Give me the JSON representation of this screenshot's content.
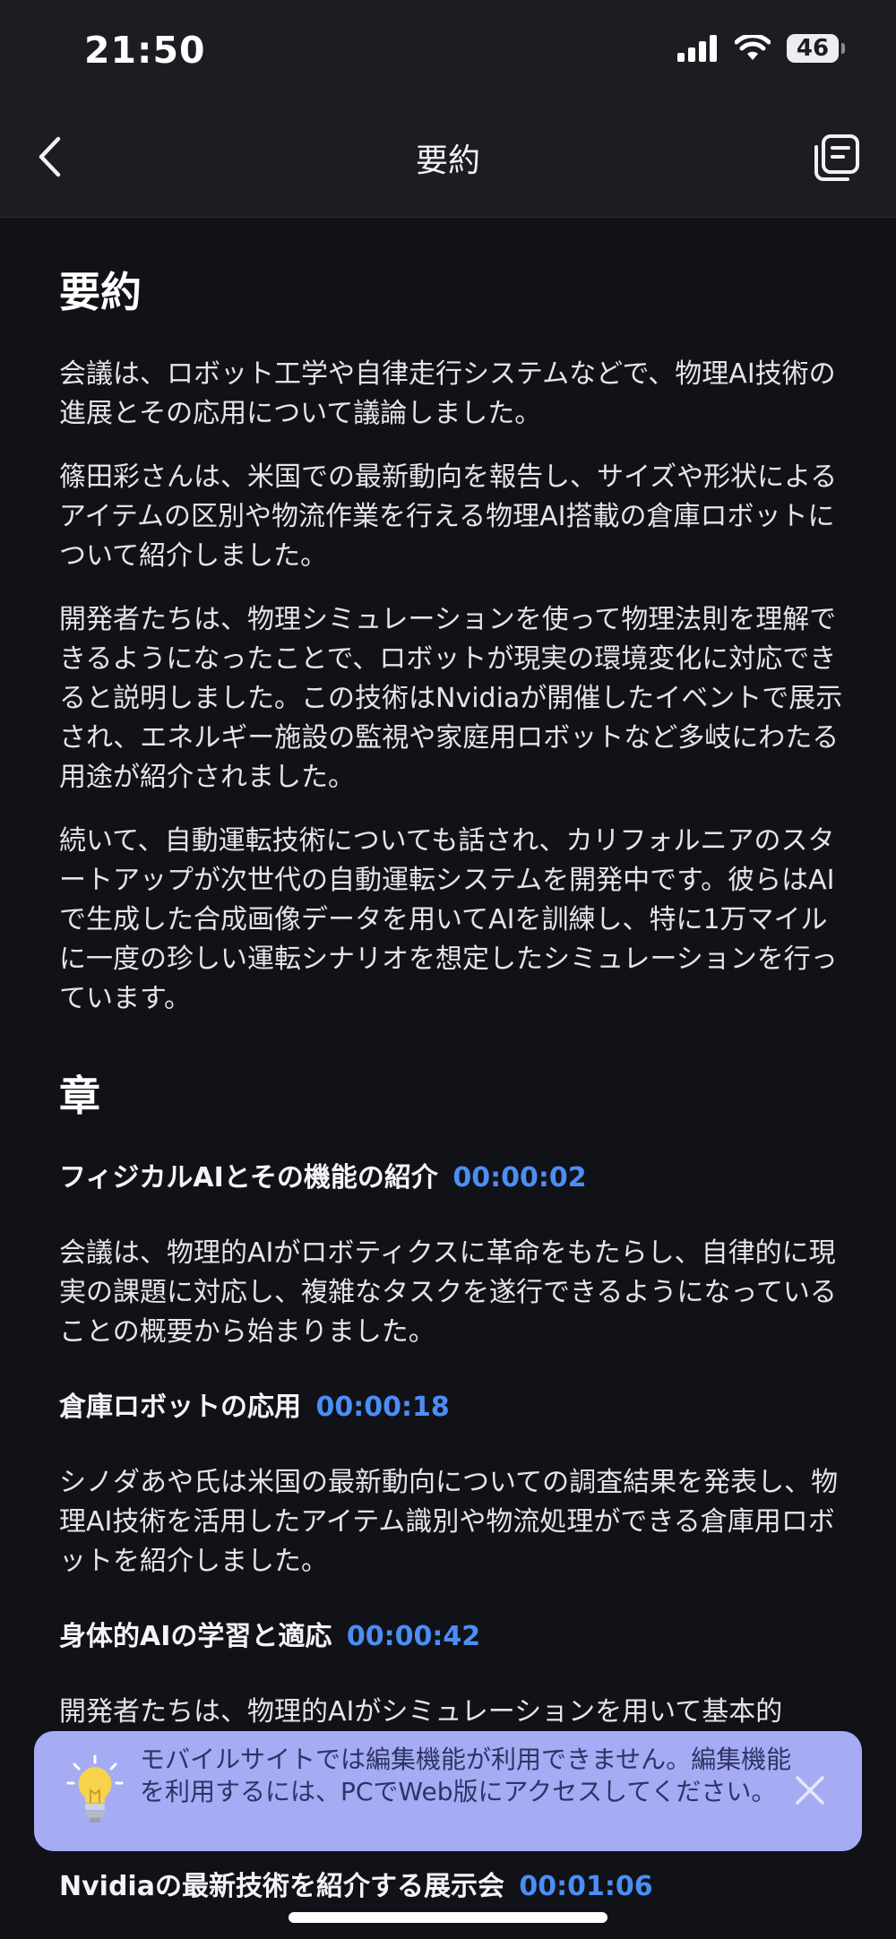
{
  "status": {
    "time": "21:50",
    "battery": "46",
    "icons": [
      "signal-icon",
      "wifi-icon",
      "battery-icon"
    ]
  },
  "nav": {
    "title": "要約",
    "back_icon": "chevron-left-icon",
    "action_icon": "transcript-icon"
  },
  "summary": {
    "heading": "要約",
    "paragraphs": [
      "会議は、ロボット工学や自律走行システムなどで、物理AI技術の進展とその応用について議論しました。",
      "篠田彩さんは、米国での最新動向を報告し、サイズや形状によるアイテムの区別や物流作業を行える物理AI搭載の倉庫ロボットについて紹介しました。",
      "開発者たちは、物理シミュレーションを使って物理法則を理解できるようになったことで、ロボットが現実の環境変化に対応できると説明しました。この技術はNvidiaが開催したイベントで展示され、エネルギー施設の監視や家庭用ロボットなど多岐にわたる用途が紹介されました。",
      "続いて、自動運転技術についても話され、カリフォルニアのスタートアップが次世代の自動運転システムを開発中です。彼らはAIで生成した合成画像データを用いてAIを訓練し、特に1万マイルに一度の珍しい運転シナリオを想定したシミュレーションを行っています。"
    ]
  },
  "chapters": {
    "heading": "章",
    "items": [
      {
        "title": "フィジカルAIとその機能の紹介",
        "time": "00:00:02",
        "body": "会議は、物理的AIがロボティクスに革命をもたらし、自律的に現実の課題に対応し、複雑なタスクを遂行できるようになっていることの概要から始まりました。"
      },
      {
        "title": "倉庫ロボットの応用",
        "time": "00:00:18",
        "body": "シノダあや氏は米国の最新動向についての調査結果を発表し、物理AI技術を活用したアイテム識別や物流処理ができる倉庫用ロボットを紹介しました。"
      },
      {
        "title": "身体的AIの学習と適応",
        "time": "00:00:42",
        "body": "開発者たちは、物理的AIがシミュレーションを用いて基本的"
      }
    ],
    "last": {
      "title": "Nvidiaの最新技術を紹介する展示会",
      "time": "00:01:06"
    }
  },
  "toast": {
    "message": "モバイルサイトでは編集機能が利用できません。編集機能を利用するには、PCでWeb版にアクセスしてください。",
    "icon": "lightbulb-icon",
    "close_icon": "close-icon"
  },
  "colors": {
    "background": "#101218",
    "header": "#1b1d22",
    "timestamp": "#4b8ef5",
    "toast": "#a5acf3"
  }
}
